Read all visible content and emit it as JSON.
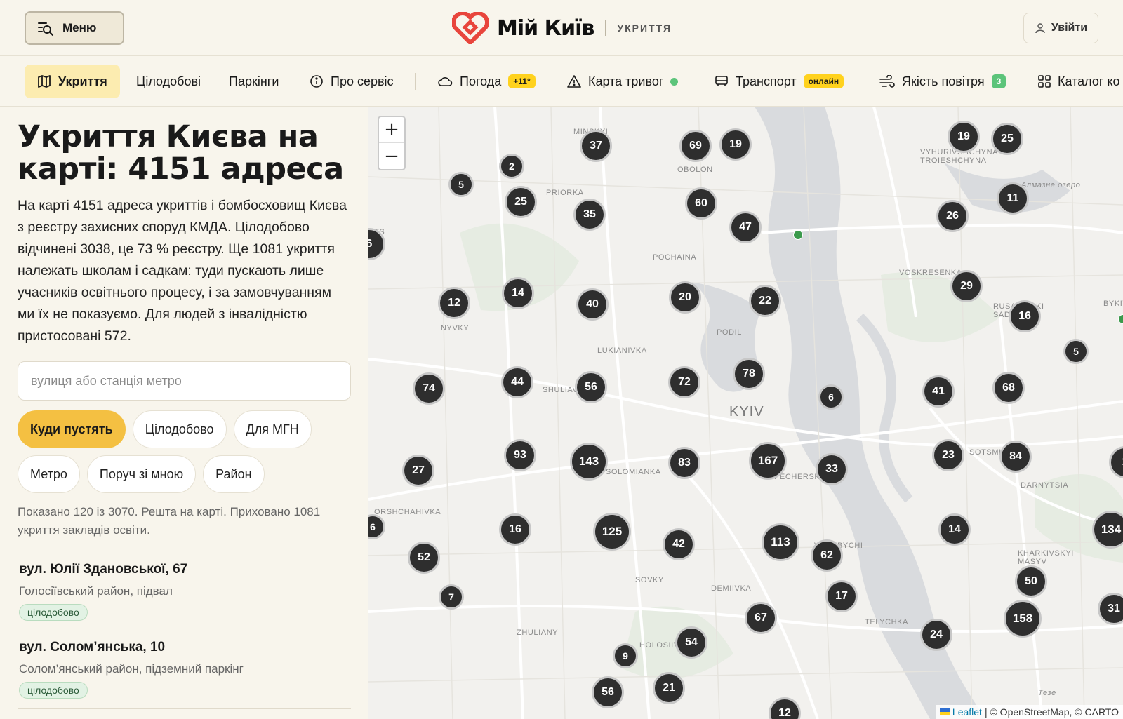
{
  "header": {
    "menu_label": "Меню",
    "brand": "Мій Київ",
    "section": "УКРИТТЯ",
    "login_label": "Увійти",
    "logo_color": "#e8453c"
  },
  "nav": {
    "items": [
      {
        "label": "Укриття",
        "icon": "map-icon",
        "active": true
      },
      {
        "label": "Цілодобові"
      },
      {
        "label": "Паркінги"
      },
      {
        "label": "Про сервіс",
        "icon": "info-icon"
      },
      {
        "label": "Погода",
        "icon": "cloud-icon",
        "badge": "+11°"
      },
      {
        "label": "Карта тривог",
        "icon": "warning-icon",
        "status": "green"
      },
      {
        "label": "Транспорт",
        "icon": "bus-icon",
        "badge": "онлайн"
      },
      {
        "label": "Якість повітря",
        "icon": "wind-icon",
        "badge": "3"
      },
      {
        "label": "Каталог ко",
        "icon": "grid-icon"
      }
    ]
  },
  "sidebar": {
    "title": "Укриття Києва на карті: 4151 адреса",
    "description": "На карті 4151 адреса укриттів і бомбосховищ Києва з реєстру захисних споруд КМДА. Цілодобово відчинені 3038, це 73 % реєстру. Ще 1081 укриття належать школам і садкам: туди пускають лише учасників освітнього процесу, і за замовчуванням ми їх не показуємо. Для людей з інвалідністю пристосовані 572.",
    "search_placeholder": "вулиця або станція метро",
    "filters": [
      "Куди пустять",
      "Цілодобово",
      "Для МГН",
      "Метро",
      "Поруч зі мною",
      "Район"
    ],
    "shown_text": "Показано 120 із 3070. Решта на карті. Приховано 1081 укриття закладів освіти.",
    "results": [
      {
        "address": "вул. Юлії Здановської, 67",
        "meta": "Голосіївський район, підвал",
        "tag": "цілодобово"
      },
      {
        "address": "вул. Солом’янська, 10",
        "meta": "Солом’янський район, підземний паркінг",
        "tag": "цілодобово"
      }
    ]
  },
  "map": {
    "zoom_in": "+",
    "zoom_out": "−",
    "attribution_leaflet": "Leaflet",
    "attribution_rest": "| © OpenStreetMap, © CARTO",
    "labels": [
      "MINSKYI",
      "OBOLON",
      "PRIORKA",
      "POCHAINA",
      "PODIL",
      "LUKIANIVKA",
      "NYVKY",
      "SHULIAV",
      "KYIV",
      "SOLOMIANKA",
      "PECHERSK",
      "VYDUBYCHI",
      "DEMIIVKA",
      "SOVKY",
      "TELYCHKA",
      "ZHULIANY",
      "HOLOSIIV",
      "VOSKRESENKA",
      "RUSANIVSKI SADY",
      "SOTSMISTO",
      "DARNYTSIA",
      "KHARKIVSKYI MASYV",
      "VYHURIVSHCHYNA-TROIESHCHYNA",
      "BYKIV",
      "Алмазне озеро",
      "ORSHCHAHIVKA",
      "TS",
      "Тезе"
    ],
    "clusters": [
      "37",
      "69",
      "19",
      "19",
      "25",
      "2",
      "5",
      "25",
      "35",
      "60",
      "47",
      "11",
      "26",
      "6",
      "14",
      "40",
      "20",
      "22",
      "29",
      "16",
      "12",
      "5",
      "74",
      "44",
      "56",
      "72",
      "78",
      "6",
      "41",
      "68",
      "93",
      "143",
      "83",
      "167",
      "33",
      "23",
      "84",
      "27",
      "16",
      "125",
      "42",
      "113",
      "62",
      "14",
      "134",
      "6",
      "52",
      "7",
      "17",
      "50",
      "67",
      "54",
      "9",
      "21",
      "56",
      "12",
      "24",
      "158",
      "31",
      "1"
    ]
  }
}
